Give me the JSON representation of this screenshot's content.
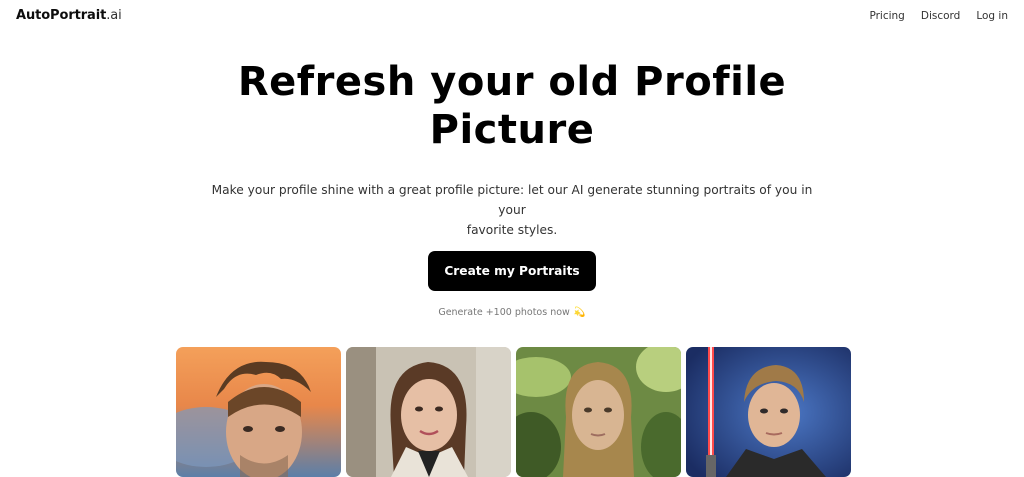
{
  "nav": {
    "logo_brand": "AutoPortrait",
    "logo_tld": ".ai",
    "links": [
      "Pricing",
      "Discord",
      "Log in"
    ]
  },
  "hero": {
    "title_line1": "Refresh your old Profile",
    "title_line2": "Picture",
    "subtitle_line1": "Make your profile shine with a great profile picture: let our AI generate stunning portraits of you in your",
    "subtitle_line2": "favorite styles.",
    "cta_label": "Create my Portraits",
    "note": "Generate +100 photos now",
    "note_emoji": "💫"
  },
  "gallery": {
    "images": [
      {
        "name": "portrait-man-sunset"
      },
      {
        "name": "portrait-woman-blazer"
      },
      {
        "name": "portrait-girl-jungle"
      },
      {
        "name": "portrait-jedi-lightsaber"
      }
    ]
  },
  "colors": {
    "cta_background": "#000000",
    "cta_text": "#ffffff",
    "note_text": "#777777"
  }
}
